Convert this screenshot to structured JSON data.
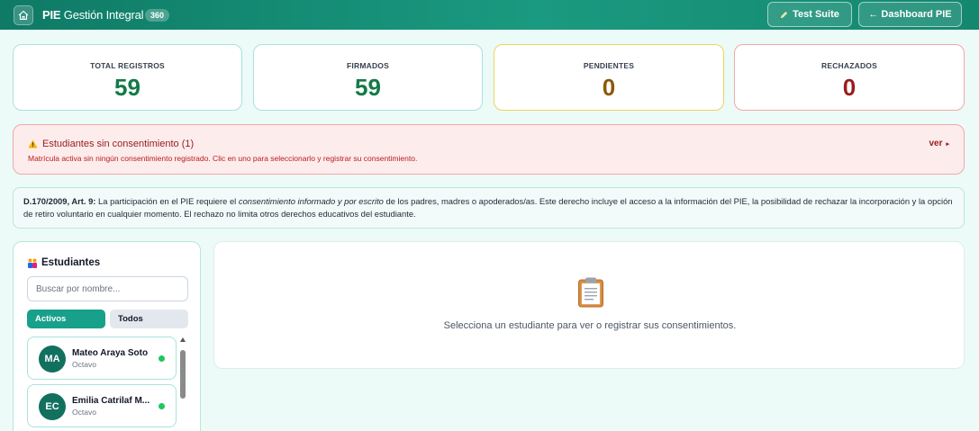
{
  "header": {
    "title_bold": "PIE",
    "title_rest": "Gestión Integral",
    "badge": "360",
    "test_suite_label": "Test Suite",
    "dashboard_label": "← Dashboard PIE"
  },
  "stats": [
    {
      "label": "TOTAL REGISTROS",
      "value": "59",
      "color": "#137a47"
    },
    {
      "label": "FIRMADOS",
      "value": "59",
      "color": "#137a47"
    },
    {
      "label": "PENDIENTES",
      "value": "0",
      "color": "#8a5a0b"
    },
    {
      "label": "RECHAZADOS",
      "value": "0",
      "color": "#9b1c1c"
    }
  ],
  "alert": {
    "title": "Estudiantes sin consentimiento (1)",
    "subtitle": "Matrícula activa sin ningún consentimiento registrado. Clic en uno para seleccionarlo y registrar su consentimiento.",
    "ver_label": "ver"
  },
  "decree": {
    "ref": "D.170/2009, Art. 9:",
    "text_before": " La participación en el PIE requiere el ",
    "emphasis": "consentimiento informado y por escrito",
    "text_after": " de los padres, madres o apoderados/as. Este derecho incluye el acceso a la información del PIE, la posibilidad de rechazar la incorporación y la opción de retiro voluntario en cualquier momento. El rechazo no limita otros derechos educativos del estudiante."
  },
  "sidebar": {
    "title": "Estudiantes",
    "search_placeholder": "Buscar por nombre...",
    "tab_active": "Activos",
    "tab_all": "Todos",
    "students": [
      {
        "initials": "MA",
        "name": "Mateo Araya Soto",
        "grade": "Octavo"
      },
      {
        "initials": "EC",
        "name": "Emilia Catrilaf M...",
        "grade": "Octavo"
      }
    ]
  },
  "detail": {
    "message": "Selecciona un estudiante para ver o registrar sus consentimientos."
  }
}
